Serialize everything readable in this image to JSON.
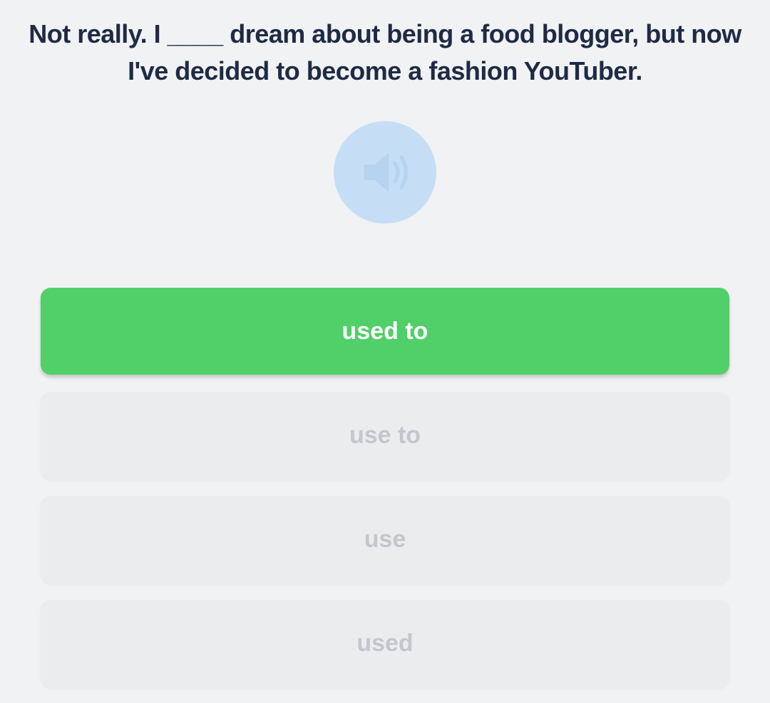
{
  "question": {
    "text": "Not really. I ____ dream about being a food blogger, but now I've decided to become a fashion YouTuber."
  },
  "audio": {
    "icon": "speaker-icon",
    "color": "#c6def5"
  },
  "options": [
    {
      "label": "used to",
      "state": "correct"
    },
    {
      "label": "use to",
      "state": "disabled"
    },
    {
      "label": "use",
      "state": "disabled"
    },
    {
      "label": "used",
      "state": "disabled"
    }
  ],
  "colors": {
    "background": "#f1f2f4",
    "correct": "#51cf68",
    "disabled_bg": "#ebecee",
    "disabled_text": "#c3c7cd",
    "question_text": "#1f2a44"
  }
}
